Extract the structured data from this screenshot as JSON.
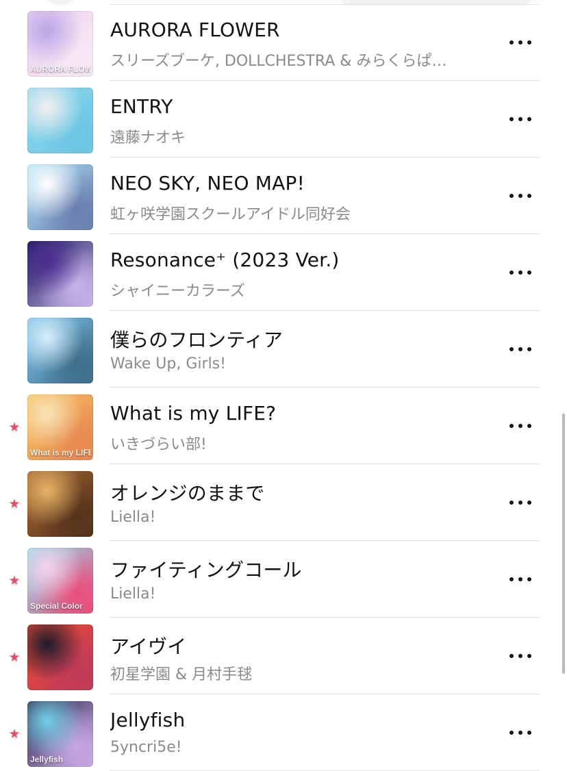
{
  "tracks": [
    {
      "title": "AURORA FLOWER",
      "artist": "スリーズブーケ, DOLLCHESTRA & みらくらぱ…",
      "favorite": false,
      "art_colors": [
        "#efd3f2",
        "#b8a6e6",
        "#f7e7f3"
      ],
      "art_text": "AURORA FLOWER"
    },
    {
      "title": "ENTRY",
      "artist": "遠藤ナオキ",
      "favorite": false,
      "art_colors": [
        "#8fd8ee",
        "#f3eff0",
        "#6bc6e4"
      ],
      "art_text": ""
    },
    {
      "title": "NEO SKY, NEO MAP!",
      "artist": "虹ヶ咲学園スクールアイドル同好会",
      "favorite": false,
      "art_colors": [
        "#aee3f6",
        "#ffffff",
        "#6a7fb0"
      ],
      "art_text": ""
    },
    {
      "title": "Resonance⁺ (2023 Ver.)",
      "artist": "シャイニーカラーズ",
      "favorite": false,
      "art_colors": [
        "#1d1b5e",
        "#4c2c8f",
        "#c6b3ea"
      ],
      "art_text": ""
    },
    {
      "title": "僕らのフロンティア",
      "artist": "Wake Up, Girls!",
      "favorite": false,
      "art_colors": [
        "#7fc4ee",
        "#d7eefa",
        "#3e6f8b"
      ],
      "art_text": ""
    },
    {
      "title": "What is my LIFE?",
      "artist": "いきづらい部!",
      "favorite": true,
      "art_colors": [
        "#f7c263",
        "#f9e3b9",
        "#e9894f"
      ],
      "art_text": "What is my LIFE?"
    },
    {
      "title": "オレンジのままで",
      "artist": "Liella!",
      "favorite": true,
      "art_colors": [
        "#a5682f",
        "#e7b368",
        "#56331c"
      ],
      "art_text": ""
    },
    {
      "title": "ファイティングコール",
      "artist": "Liella!",
      "favorite": true,
      "art_colors": [
        "#8ee0f2",
        "#f6d3ea",
        "#e94f7b"
      ],
      "art_text": "Special Color"
    },
    {
      "title": "アイヴイ",
      "artist": "初星学園 & 月村手毬",
      "favorite": true,
      "art_colors": [
        "#e94d2f",
        "#1b1b2e",
        "#c13a58"
      ],
      "art_text": ""
    },
    {
      "title": "Jellyfish",
      "artist": "5yncri5e!",
      "favorite": true,
      "art_colors": [
        "#2a2a4a",
        "#6fd0e8",
        "#c9a6e6"
      ],
      "art_text": "Jellyfish"
    }
  ],
  "icons": {
    "favorite": "star-icon",
    "more": "ellipsis-icon"
  },
  "colors": {
    "favorite_star": "#f5455c",
    "title": "#111111",
    "artist": "#8a8a8e",
    "divider": "#e1e1e4"
  }
}
